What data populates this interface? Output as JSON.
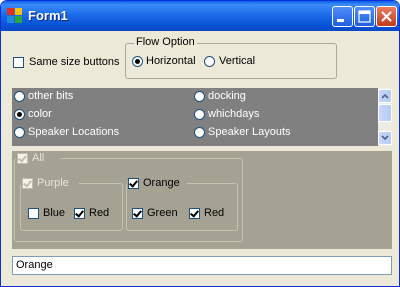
{
  "window": {
    "title": "Form1"
  },
  "top": {
    "same_size_label": "Same size buttons",
    "flow_option": {
      "legend": "Flow Option",
      "horizontal": "Horizontal",
      "vertical": "Vertical",
      "selected": "Horizontal"
    }
  },
  "radio_list": {
    "items": [
      {
        "label": "other bits",
        "selected": false
      },
      {
        "label": "docking",
        "selected": false
      },
      {
        "label": "color",
        "selected": true
      },
      {
        "label": "whichdays",
        "selected": false
      },
      {
        "label": "Speaker Locations",
        "selected": false
      },
      {
        "label": "Speaker Layouts",
        "selected": false
      }
    ]
  },
  "tree": {
    "all_label": "All",
    "purple": {
      "label": "Purple",
      "blue": "Blue",
      "red": "Red"
    },
    "orange": {
      "label": "Orange",
      "green": "Green",
      "red": "Red"
    }
  },
  "output": {
    "value": "Orange"
  },
  "colors": {
    "title_bar": "#0a5ee8",
    "list_bg": "#808080",
    "tree_bg": "#a5a293",
    "window_bg": "#ece9d8"
  }
}
